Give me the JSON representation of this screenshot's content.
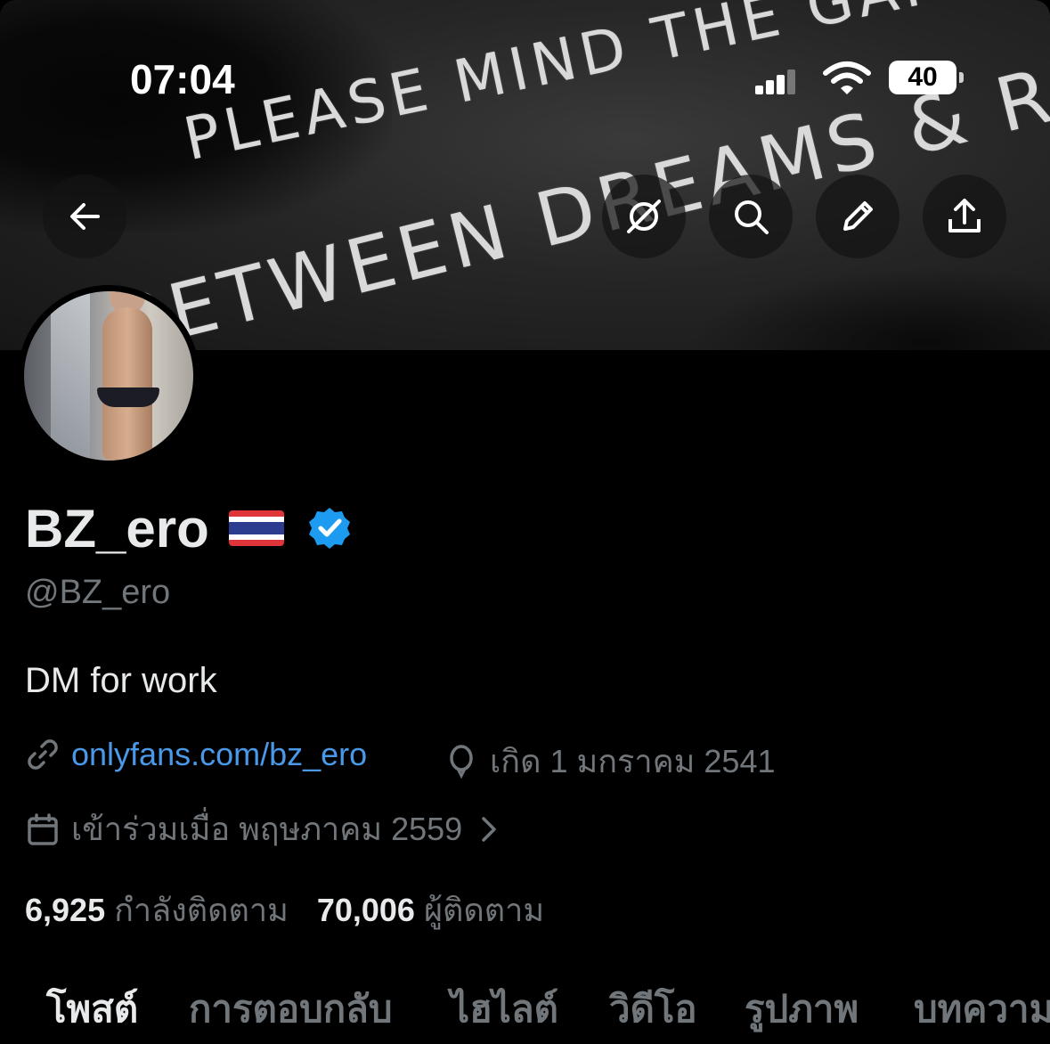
{
  "status_bar": {
    "time": "07:04",
    "battery": "40"
  },
  "banner": {
    "line1": "PLEASE MIND THE GAP",
    "line2": "BETWEEN DREAMS & REALITY"
  },
  "header_buttons": [
    "back-arrow-icon",
    "grok-icon",
    "search-icon",
    "edit-pencil-icon",
    "share-icon"
  ],
  "profile": {
    "name": "BZ_ero",
    "flag": "thai-flag",
    "verified_color": "#1d9bf0",
    "handle": "@BZ_ero",
    "bio": "DM for work",
    "link": "onlyfans.com/bz_ero",
    "birthday": "เกิด 1 มกราคม 2541",
    "joined": "เข้าร่วมเมื่อ พฤษภาคม 2559",
    "following_count": "6,925",
    "following_label": "กำลังติดตาม",
    "followers_count": "70,006",
    "followers_label": "ผู้ติดตาม"
  },
  "tabs": [
    {
      "label": "โพสต์",
      "active": true
    },
    {
      "label": "การตอบกลับ",
      "active": false
    },
    {
      "label": "ไฮไลต์",
      "active": false
    },
    {
      "label": "วิดีโอ",
      "active": false
    },
    {
      "label": "รูปภาพ",
      "active": false
    },
    {
      "label": "บทความ",
      "active": false
    }
  ],
  "colors": {
    "background": "#000000",
    "text": "#e7e9ea",
    "secondary": "#71767b",
    "link": "#4a99e9",
    "accent": "#1d9bf0"
  }
}
